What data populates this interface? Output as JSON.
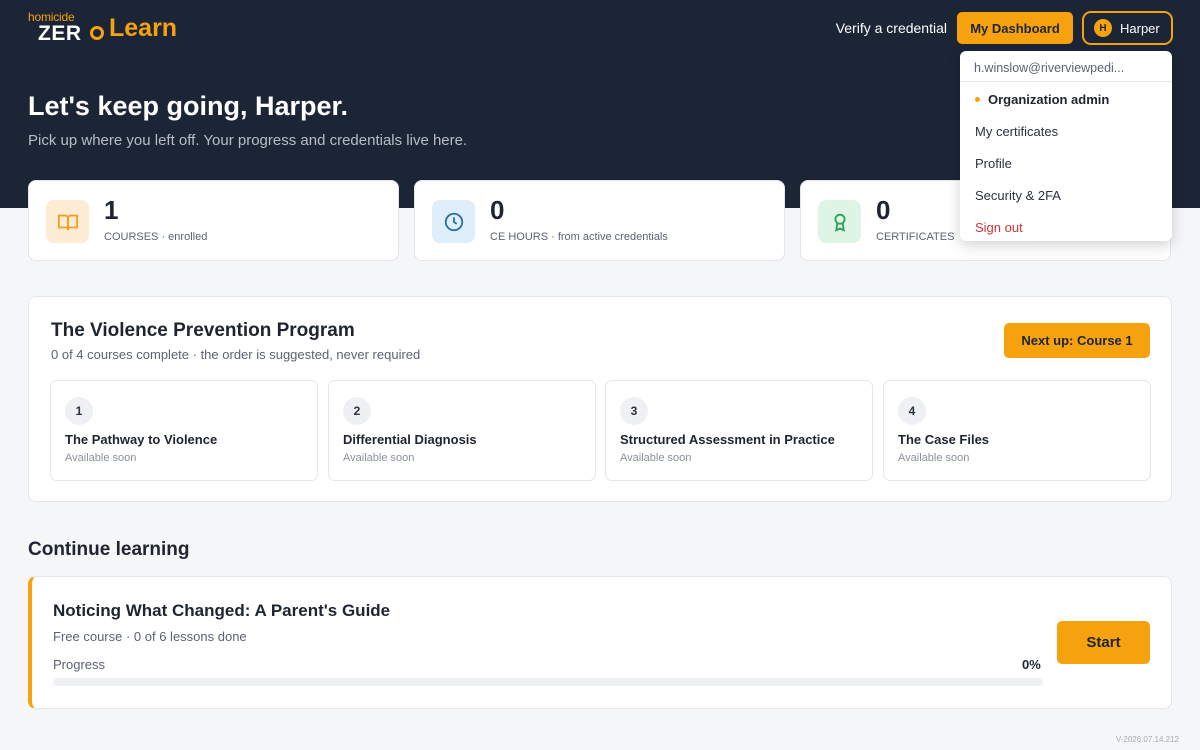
{
  "brand": {
    "small": "homicide",
    "zero": "ZER",
    "learn": "Learn",
    "accent": "#f6a10e",
    "dark": "#1c2536"
  },
  "header": {
    "verify_link": "Verify a credential",
    "dashboard_button": "My Dashboard",
    "user_name": "Harper",
    "user_initial": "H"
  },
  "user_menu": {
    "email": "h.winslow@riverviewpedi...",
    "items": [
      {
        "label": "Organization admin",
        "active": true
      },
      {
        "label": "My certificates"
      },
      {
        "label": "Profile"
      },
      {
        "label": "Security & 2FA"
      },
      {
        "label": "Sign out",
        "danger": true
      }
    ]
  },
  "hero": {
    "title": "Let's keep going, Harper.",
    "subtitle": "Pick up where you left off. Your progress and credentials live here."
  },
  "stats": [
    {
      "value": "1",
      "label": "COURSES · enrolled",
      "icon": "book-icon",
      "tint": "#fdecd3",
      "color": "#f0a020"
    },
    {
      "value": "0",
      "label": "CE HOURS · from active credentials",
      "icon": "clock-icon",
      "tint": "#dfeefb",
      "color": "#2a6fa8"
    },
    {
      "value": "0",
      "label": "CERTIFICATES",
      "icon": "award-icon",
      "tint": "#def5e6",
      "color": "#2f9e5a"
    }
  ],
  "program": {
    "title": "The Violence Prevention Program",
    "subtitle": "0 of 4 courses complete · the order is suggested, never required",
    "next_button": "Next up: Course 1",
    "courses": [
      {
        "number": "1",
        "name": "The Pathway to Violence",
        "status": "Available soon"
      },
      {
        "number": "2",
        "name": "Differential Diagnosis",
        "status": "Available soon"
      },
      {
        "number": "3",
        "name": "Structured Assessment in Practice",
        "status": "Available soon"
      },
      {
        "number": "4",
        "name": "The Case Files",
        "status": "Available soon"
      }
    ]
  },
  "continue": {
    "section_title": "Continue learning",
    "course_title": "Noticing What Changed: A Parent's Guide",
    "course_meta": "Free course · 0 of 6 lessons done",
    "progress_label": "Progress",
    "progress_text": "0%",
    "progress_value": 0,
    "start_button": "Start"
  },
  "footer": {
    "version": "V-2026.07.14.212"
  }
}
